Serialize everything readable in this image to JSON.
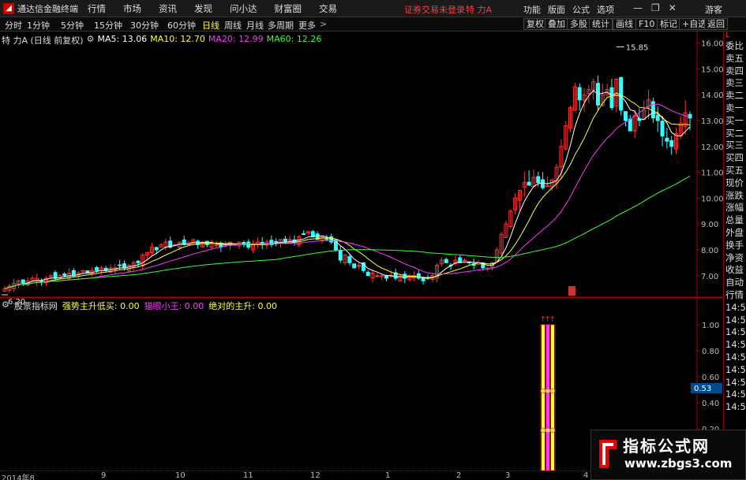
{
  "titlebar": {
    "app_name": "通达信金融终端",
    "menu": [
      "行情",
      "市场",
      "资讯",
      "发现",
      "问小达",
      "财富圈",
      "交易"
    ],
    "login_warning": "证券交易未登录",
    "stock_name": "特 力A",
    "links": [
      "功能",
      "版面",
      "公式",
      "选项"
    ],
    "guest": "游客"
  },
  "periodbar": {
    "periods": [
      "分时",
      "1分钟",
      "5分钟",
      "15分钟",
      "30分钟",
      "60分钟",
      "日线",
      "周线",
      "月线",
      "多周期",
      "更多"
    ],
    "active_period": "日线",
    "tools": [
      "复权",
      "叠加",
      "多股",
      "统计",
      "画线",
      "F10",
      "标记",
      "+自选",
      "返回"
    ]
  },
  "price_info": {
    "title": "特 力A (日线 前复权)",
    "ma5": "MA5: 13.06",
    "ma10": "MA10: 12.70",
    "ma20": "MA20: 12.99",
    "ma60": "MA60: 12.26"
  },
  "indicator_info": {
    "name": "股票指标网",
    "line1": "强势主升低买: 0.00",
    "line2": "猫眼小王: 0.00",
    "line3": "绝对的主升: 0.00"
  },
  "side_panel": {
    "top_label": "L",
    "items": [
      "委比",
      "卖五",
      "卖四",
      "卖三",
      "卖二",
      "卖一",
      "买一",
      "买二",
      "买三",
      "买四",
      "买五",
      "现价",
      "涨跌",
      "涨幅",
      "总量",
      "外盘",
      "换手",
      "净资",
      "收益",
      "自动",
      "行情",
      "14:5",
      "14:5",
      "14:5",
      "14:5",
      "14:5",
      "14:5",
      "14:5",
      "14:5",
      "14:5"
    ]
  },
  "colors": {
    "up": "#ff3333",
    "down": "#33ffff",
    "ma5": "#ffffff",
    "ma10": "#ffff33",
    "ma20": "#ff33ff",
    "ma60": "#33ff33",
    "axis": "#b00000"
  },
  "chart_data": {
    "type": "candlestick",
    "price_axis": [
      16.0,
      15.0,
      14.0,
      13.0,
      12.0,
      11.0,
      10.0,
      9.0,
      8.0,
      7.0
    ],
    "ylim": [
      6.2,
      16.2
    ],
    "high_label": "15.85",
    "low_label": "6.20",
    "indicator_axis": [
      "1.00",
      "0.80",
      "0.60",
      "0.40",
      "0.20"
    ],
    "indicator_current": "0.53",
    "x_ticks": [
      "2014年8",
      "9",
      "10",
      "11",
      "12",
      "1",
      "2",
      "3",
      "4"
    ],
    "closes": [
      6.5,
      6.6,
      6.7,
      6.8,
      6.7,
      6.8,
      6.9,
      6.9,
      6.8,
      6.9,
      7.0,
      6.9,
      7.0,
      7.0,
      7.1,
      7.0,
      7.1,
      7.2,
      7.1,
      7.2,
      7.2,
      7.3,
      7.2,
      7.3,
      7.3,
      7.4,
      7.3,
      7.4,
      7.5,
      7.5,
      7.8,
      7.9,
      8.1,
      8.0,
      8.2,
      8.3,
      8.1,
      8.2,
      8.3,
      8.2,
      8.3,
      8.4,
      8.2,
      8.3,
      8.2,
      8.3,
      8.2,
      8.1,
      8.2,
      8.3,
      8.2,
      8.3,
      8.2,
      8.1,
      8.2,
      8.3,
      8.2,
      8.3,
      8.2,
      8.3,
      8.4,
      8.3,
      8.4,
      8.3,
      8.5,
      8.6,
      8.7,
      8.5,
      8.4,
      8.5,
      8.4,
      8.3,
      8.0,
      7.6,
      7.8,
      7.5,
      7.3,
      7.4,
      7.2,
      7.0,
      7.1,
      7.0,
      7.0,
      6.9,
      7.0,
      6.9,
      7.0,
      6.9,
      7.0,
      7.0,
      6.9,
      6.8,
      6.9,
      7.0,
      7.4,
      7.6,
      7.5,
      7.4,
      7.6,
      7.5,
      7.6,
      7.5,
      7.4,
      7.5,
      7.3,
      7.3,
      7.5,
      8.0,
      8.6,
      9.0,
      9.5,
      10.0,
      10.3,
      10.6,
      10.5,
      10.8,
      10.6,
      10.4,
      10.5,
      10.7,
      11.2,
      12.0,
      12.8,
      13.5,
      14.3,
      13.8,
      14.0,
      14.2,
      14.5,
      13.6,
      14.0,
      14.2,
      13.5,
      14.6,
      13.4,
      13.0,
      12.6,
      13.2,
      13.0,
      13.4,
      13.8,
      13.1,
      13.0,
      12.4,
      12.2,
      12.0,
      12.5,
      12.9,
      13.3,
      13.1
    ]
  }
}
